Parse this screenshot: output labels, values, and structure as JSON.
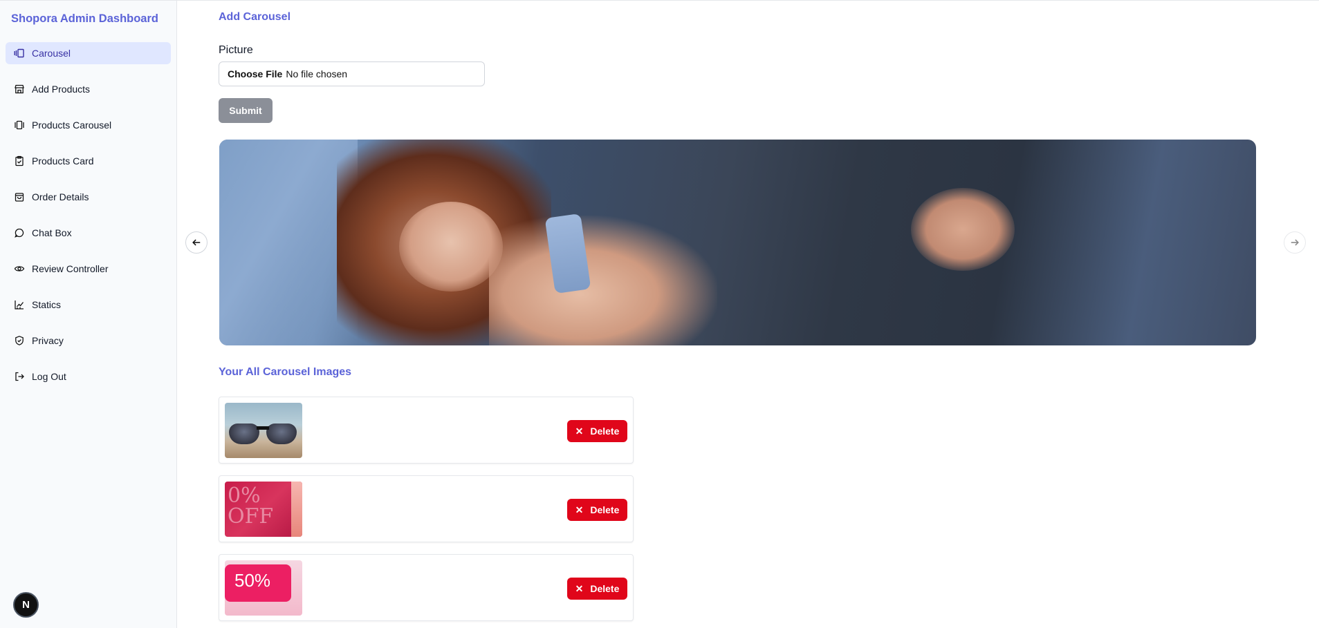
{
  "app": {
    "brand": "Shopora Admin Dashboard"
  },
  "sidebar": {
    "items": [
      {
        "label": "Carousel",
        "icon": "carousel-icon",
        "active": true
      },
      {
        "label": "Add Products",
        "icon": "store-icon",
        "active": false
      },
      {
        "label": "Products Carousel",
        "icon": "gallery-icon",
        "active": false
      },
      {
        "label": "Products Card",
        "icon": "clipboard-icon",
        "active": false
      },
      {
        "label": "Order Details",
        "icon": "shopping-bag-icon",
        "active": false
      },
      {
        "label": "Chat Box",
        "icon": "chat-icon",
        "active": false
      },
      {
        "label": "Review Controller",
        "icon": "eye-icon",
        "active": false
      },
      {
        "label": "Statics",
        "icon": "chart-icon",
        "active": false
      },
      {
        "label": "Privacy",
        "icon": "shield-icon",
        "active": false
      },
      {
        "label": "Log Out",
        "icon": "logout-icon",
        "active": false
      }
    ],
    "badge": "N"
  },
  "form": {
    "title": "Add Carousel",
    "picture_label": "Picture",
    "choose_file": "Choose File",
    "file_status": "No file chosen",
    "submit_label": "Submit"
  },
  "gallery": {
    "title": "Your All Carousel Images",
    "delete_label": "Delete",
    "items": [
      {
        "thumb_text": ""
      },
      {
        "thumb_text": "0% OFF"
      },
      {
        "thumb_text": "50%"
      }
    ]
  },
  "colors": {
    "accent": "#5b63d8",
    "active_bg": "#e0e7ff",
    "delete": "#e0061a",
    "submit_disabled": "#8b8f98"
  }
}
